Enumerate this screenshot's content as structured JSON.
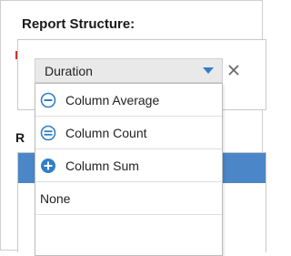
{
  "header": {
    "title": "Report Structure:"
  },
  "section": {
    "label_fragment": "R"
  },
  "aggregate_select": {
    "selected": "Duration",
    "clear_label": "×"
  },
  "dropdown": {
    "items": [
      {
        "label": "Column Average",
        "icon": "minus-circle-icon"
      },
      {
        "label": "Column Count",
        "icon": "equals-circle-icon"
      },
      {
        "label": "Column Sum",
        "icon": "plus-circle-icon"
      },
      {
        "label": "None",
        "icon": ""
      }
    ]
  },
  "colors": {
    "accent": "#2f7fc8",
    "table_header": "#4a86c8"
  }
}
